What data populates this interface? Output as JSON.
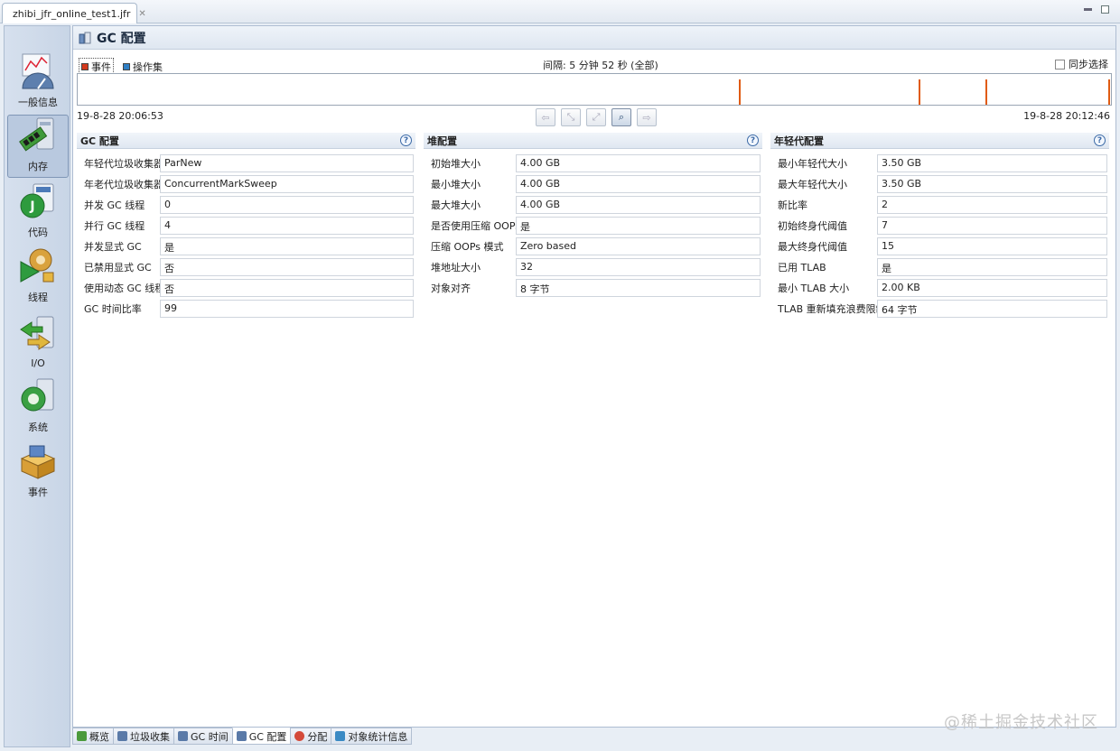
{
  "editor_tab": {
    "title": "zhibi_jfr_online_test1.jfr",
    "close": "✕"
  },
  "nav": [
    {
      "label": "一般信息",
      "icon": "gauge-chart-icon"
    },
    {
      "label": "内存",
      "icon": "memory-chip-icon"
    },
    {
      "label": "代码",
      "icon": "code-java-icon"
    },
    {
      "label": "线程",
      "icon": "threads-gear-icon"
    },
    {
      "label": "I/O",
      "icon": "io-arrows-icon"
    },
    {
      "label": "系统",
      "icon": "system-refresh-icon"
    },
    {
      "label": "事件",
      "icon": "events-box-icon"
    }
  ],
  "page": {
    "title": "GC 配置"
  },
  "timeline": {
    "legend": [
      {
        "label": "事件",
        "color": "#d43a1e"
      },
      {
        "label": "操作集",
        "color": "#2f7fc4"
      }
    ],
    "interval": "间隔: 5 分钟 52 秒 (全部)",
    "sync_label": "同步选择",
    "start": "19-8-28 20:06:53",
    "end": "19-8-28 20:12:46",
    "event_fractions": [
      0.641,
      0.815,
      0.88,
      0.999
    ],
    "event_color": "#e05b12"
  },
  "panels": {
    "gc": {
      "title": "GC 配置",
      "rows": [
        {
          "label": "年轻代垃圾收集器",
          "value": "ParNew"
        },
        {
          "label": "年老代垃圾收集器",
          "value": "ConcurrentMarkSweep"
        },
        {
          "label": "并发 GC 线程",
          "value": "0"
        },
        {
          "label": "并行 GC 线程",
          "value": "4"
        },
        {
          "label": "并发显式 GC",
          "value": "是"
        },
        {
          "label": "已禁用显式 GC",
          "value": "否"
        },
        {
          "label": "使用动态 GC 线程",
          "value": "否"
        },
        {
          "label": "GC 时间比率",
          "value": "99"
        }
      ]
    },
    "heap": {
      "title": "堆配置",
      "rows": [
        {
          "label": "初始堆大小",
          "value": "4.00 GB"
        },
        {
          "label": "最小堆大小",
          "value": "4.00 GB"
        },
        {
          "label": "最大堆大小",
          "value": "4.00 GB"
        },
        {
          "label": "是否使用压缩 OOPs",
          "value": "是"
        },
        {
          "label": "压缩 OOPs 模式",
          "value": "Zero based"
        },
        {
          "label": "堆地址大小",
          "value": "32"
        },
        {
          "label": "对象对齐",
          "value": "8 字节"
        }
      ]
    },
    "young": {
      "title": "年轻代配置",
      "rows": [
        {
          "label": "最小年轻代大小",
          "value": "3.50 GB"
        },
        {
          "label": "最大年轻代大小",
          "value": "3.50 GB"
        },
        {
          "label": "新比率",
          "value": "2"
        },
        {
          "label": "初始终身代阈值",
          "value": "7"
        },
        {
          "label": "最大终身代阈值",
          "value": "15"
        },
        {
          "label": "已用 TLAB",
          "value": "是"
        },
        {
          "label": "最小 TLAB 大小",
          "value": "2.00 KB"
        },
        {
          "label": "TLAB 重新填充浪费限制",
          "value": "64 字节"
        }
      ]
    }
  },
  "bottom_tabs": [
    {
      "label": "概览",
      "color": "#4b9a3c"
    },
    {
      "label": "垃圾收集",
      "color": "#5a7aa8"
    },
    {
      "label": "GC 时间",
      "color": "#5a7aa8"
    },
    {
      "label": "GC 配置",
      "color": "#5a7aa8"
    },
    {
      "label": "分配",
      "color": "#d44a3a"
    },
    {
      "label": "对象统计信息",
      "color": "#3a8ac4"
    }
  ],
  "watermark": "@稀土掘金技术社区"
}
